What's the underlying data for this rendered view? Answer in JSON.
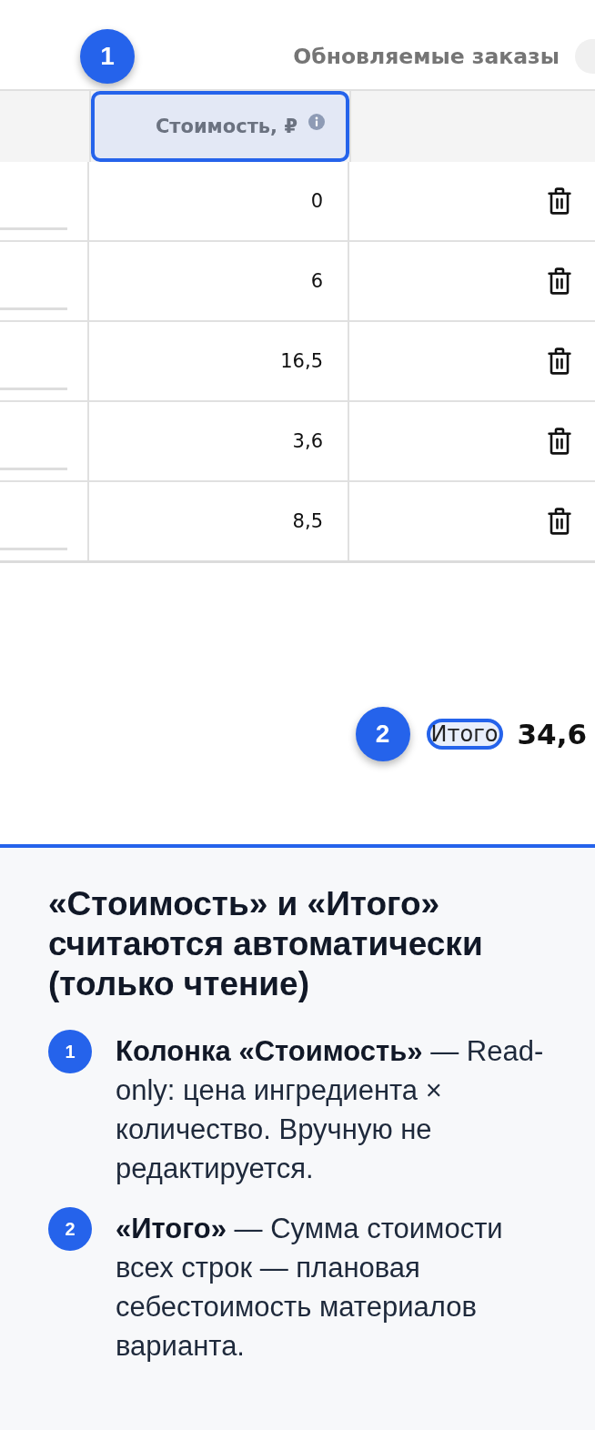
{
  "toolbar": {
    "marker": "1",
    "title": "Обновляемые заказы"
  },
  "table": {
    "header": {
      "label": "Стоимость, ₽",
      "highlighted": true
    },
    "rows": [
      {
        "cost": "0"
      },
      {
        "cost": "6"
      },
      {
        "cost": "16,5"
      },
      {
        "cost": "3,6"
      },
      {
        "cost": "8,5"
      }
    ]
  },
  "total": {
    "marker": "2",
    "label": "Итого",
    "highlighted": true,
    "value": "34,6"
  },
  "note": {
    "title": "«Стоимость» и «Итого» считаются автоматически (только чтение)",
    "items": [
      {
        "marker": "1",
        "text": "**Колонка «Стоимость»** — Read-only: цена ингредиента × количество. Вручную не редактируется."
      },
      {
        "marker": "2",
        "text": "**«Итого»** — Сумма стоимости всех строк — плановая себестоимость материалов варианта."
      }
    ]
  }
}
